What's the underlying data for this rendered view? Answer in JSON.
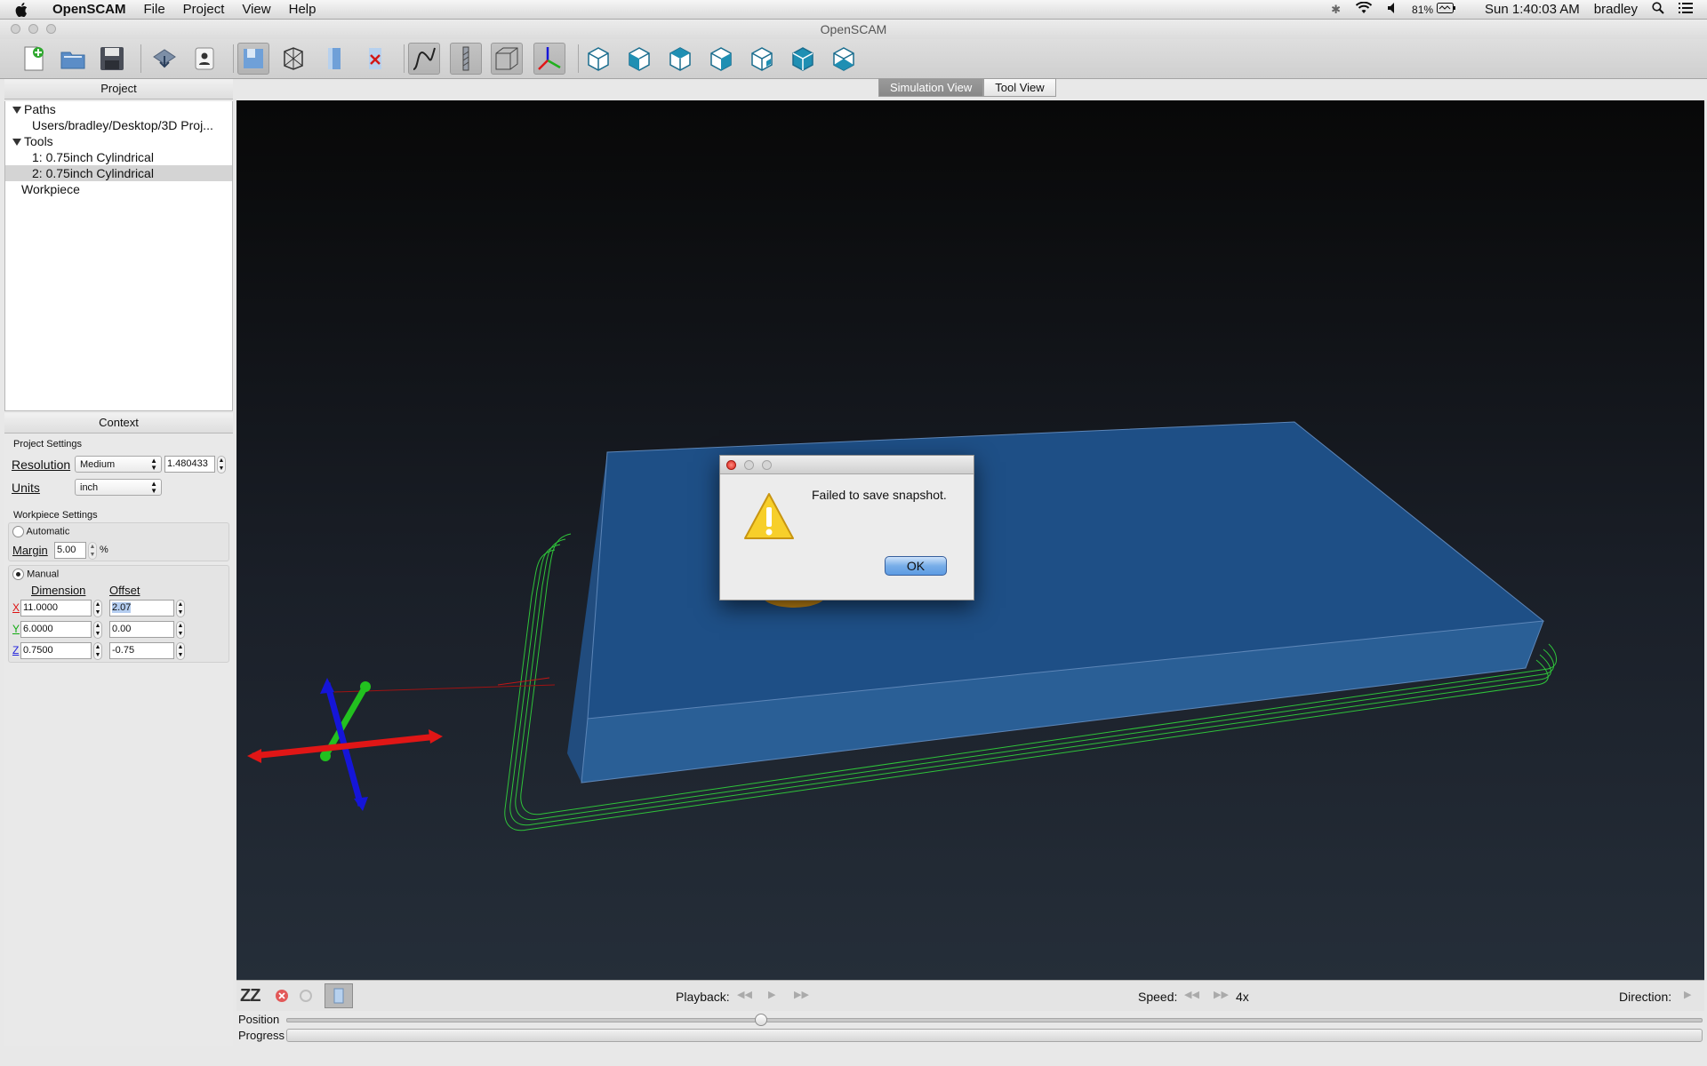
{
  "menubar": {
    "app_name": "OpenSCAM",
    "items": [
      "File",
      "Project",
      "View",
      "Help"
    ],
    "battery": "81%",
    "clock": "Sun 1:40:03 AM",
    "user": "bradley"
  },
  "window": {
    "title": "OpenSCAM"
  },
  "toolbar": {
    "buttons": [
      "new-project-icon",
      "open-project-icon",
      "save-project-icon",
      "export-icon",
      "settings-icon",
      "snapshot-icon",
      "wireframe-icon",
      "workpiece-icon",
      "clear-icon",
      "path-icon",
      "tool-icon",
      "surface-icon",
      "axes-icon",
      "view-iso-icon",
      "view-front-icon",
      "view-top-icon",
      "view-left-icon",
      "view-right-icon",
      "view-back-icon",
      "view-bottom-icon"
    ]
  },
  "project_panel": {
    "title": "Project",
    "tree": {
      "paths_label": "Paths",
      "path_item": "Users/bradley/Desktop/3D Proj...",
      "tools_label": "Tools",
      "tool_items": [
        "1: 0.75inch Cylindrical",
        "2: 0.75inch Cylindrical"
      ],
      "workpiece_label": "Workpiece"
    }
  },
  "context_panel": {
    "title": "Context",
    "project_settings": {
      "title": "Project Settings",
      "resolution_label": "Resolution",
      "resolution_value": "Medium",
      "resolution_number": "1.480433",
      "units_label": "Units",
      "units_value": "inch"
    },
    "workpiece_settings": {
      "title": "Workpiece Settings",
      "automatic_label": "Automatic",
      "margin_label": "Margin",
      "margin_value": "5.00",
      "margin_unit": "%",
      "manual_label": "Manual",
      "dimension_header": "Dimension",
      "offset_header": "Offset",
      "rows": [
        {
          "axis": "X",
          "dimension": "11.0000",
          "offset": "2.07"
        },
        {
          "axis": "Y",
          "dimension": "6.0000",
          "offset": "0.00"
        },
        {
          "axis": "Z",
          "dimension": "0.7500",
          "offset": "-0.75"
        }
      ]
    }
  },
  "view_tabs": [
    "Simulation View",
    "Tool View"
  ],
  "dialog": {
    "message": "Failed to save snapshot.",
    "ok_label": "OK"
  },
  "playback": {
    "sleep_label": "ZZ",
    "playback_label": "Playback:",
    "speed_label": "Speed:",
    "speed_value": "4x",
    "direction_label": "Direction:",
    "position_label": "Position",
    "progress_label": "Progress",
    "position_fraction": 0.335
  },
  "colors": {
    "workpiece": "#1e4f86",
    "toolpath": "#2fc43a",
    "axis_x": "#e01616",
    "axis_y": "#22c11f",
    "axis_z": "#1515d8",
    "ok_button": "#5d9be3"
  }
}
